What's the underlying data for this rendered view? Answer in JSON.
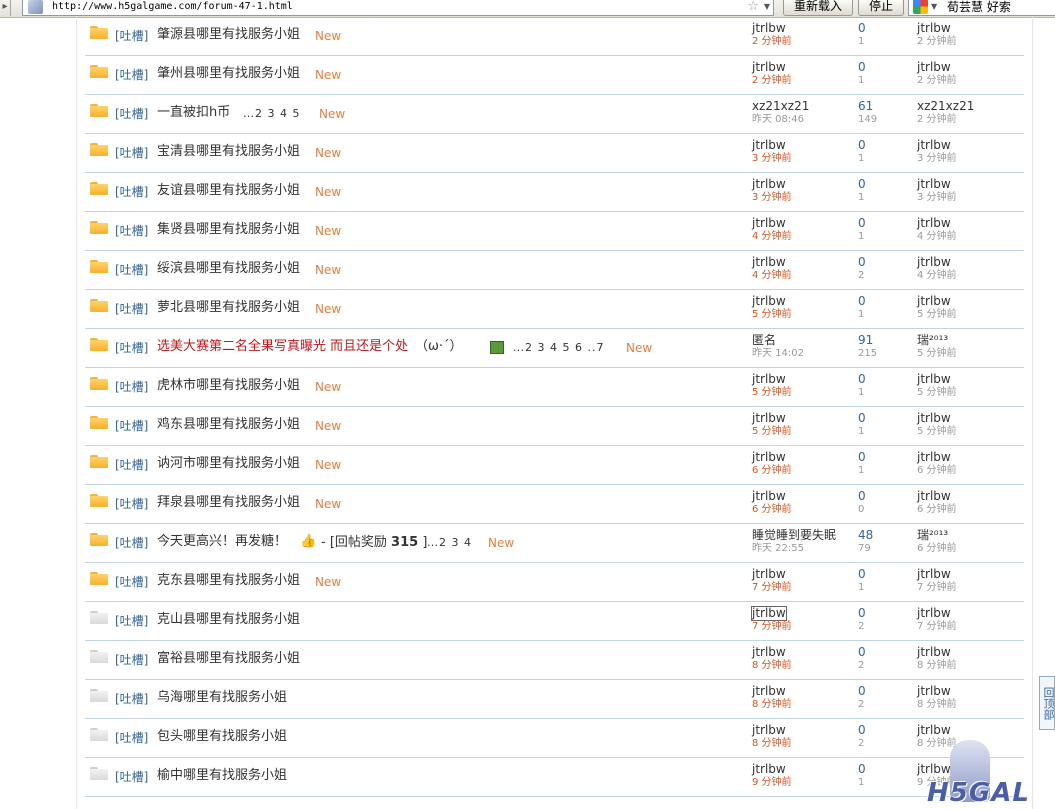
{
  "browser": {
    "url": "http://www.h5galgame.com/forum-47-1.html",
    "reload_label": "重新载入",
    "stop_label": "停止",
    "search_text": "荀芸慧 好索"
  },
  "threads": [
    {
      "icon": "new",
      "category": "[吐槽]",
      "subject": "肇源县哪里有找服务小姐",
      "new": "New",
      "author": "jtrlbw",
      "author_time": "2 分钟前",
      "replies": "0",
      "views": "1",
      "last_user": "jtrlbw",
      "last_time": "2 分钟前"
    },
    {
      "icon": "new",
      "category": "[吐槽]",
      "subject": "肇州县哪里有找服务小姐",
      "new": "New",
      "author": "jtrlbw",
      "author_time": "2 分钟前",
      "replies": "0",
      "views": "1",
      "last_user": "jtrlbw",
      "last_time": "2 分钟前"
    },
    {
      "icon": "new",
      "category": "[吐槽]",
      "subject": "一直被扣h币",
      "pages": "…2 3 4 5",
      "new": "New",
      "author": "xz21xz21",
      "author_time": "昨天 08:46",
      "replies": "61",
      "views": "149",
      "last_user": "xz21xz21",
      "last_time": "2 分钟前"
    },
    {
      "icon": "new",
      "category": "[吐槽]",
      "subject": "宝清县哪里有找服务小姐",
      "new": "New",
      "author": "jtrlbw",
      "author_time": "3 分钟前",
      "replies": "0",
      "views": "1",
      "last_user": "jtrlbw",
      "last_time": "3 分钟前"
    },
    {
      "icon": "new",
      "category": "[吐槽]",
      "subject": "友谊县哪里有找服务小姐",
      "new": "New",
      "author": "jtrlbw",
      "author_time": "3 分钟前",
      "replies": "0",
      "views": "1",
      "last_user": "jtrlbw",
      "last_time": "3 分钟前"
    },
    {
      "icon": "new",
      "category": "[吐槽]",
      "subject": "集贤县哪里有找服务小姐",
      "new": "New",
      "author": "jtrlbw",
      "author_time": "4 分钟前",
      "replies": "0",
      "views": "1",
      "last_user": "jtrlbw",
      "last_time": "4 分钟前"
    },
    {
      "icon": "new",
      "category": "[吐槽]",
      "subject": "绥滨县哪里有找服务小姐",
      "new": "New",
      "author": "jtrlbw",
      "author_time": "4 分钟前",
      "replies": "0",
      "views": "2",
      "last_user": "jtrlbw",
      "last_time": "4 分钟前"
    },
    {
      "icon": "new",
      "category": "[吐槽]",
      "subject": "萝北县哪里有找服务小姐",
      "new": "New",
      "author": "jtrlbw",
      "author_time": "5 分钟前",
      "replies": "0",
      "views": "1",
      "last_user": "jtrlbw",
      "last_time": "5 分钟前"
    },
    {
      "icon": "new",
      "category": "[吐槽]",
      "subject": "选美大赛第二名全果写真曝光 而且还是个处",
      "subject_extra": "（ω·´）",
      "pages": "…2 3 4 5 6 ..7",
      "new": "New",
      "author": "匿名",
      "author_time": "昨天 14:02",
      "replies": "91",
      "views": "215",
      "last_user": "瑞²⁰¹³",
      "last_time": "5 分钟前"
    },
    {
      "icon": "new",
      "category": "[吐槽]",
      "subject": "虎林市哪里有找服务小姐",
      "new": "New",
      "author": "jtrlbw",
      "author_time": "5 分钟前",
      "replies": "0",
      "views": "1",
      "last_user": "jtrlbw",
      "last_time": "5 分钟前"
    },
    {
      "icon": "new",
      "category": "[吐槽]",
      "subject": "鸡东县哪里有找服务小姐",
      "new": "New",
      "author": "jtrlbw",
      "author_time": "5 分钟前",
      "replies": "0",
      "views": "1",
      "last_user": "jtrlbw",
      "last_time": "5 分钟前"
    },
    {
      "icon": "new",
      "category": "[吐槽]",
      "subject": "讷河市哪里有找服务小姐",
      "new": "New",
      "author": "jtrlbw",
      "author_time": "6 分钟前",
      "replies": "0",
      "views": "1",
      "last_user": "jtrlbw",
      "last_time": "6 分钟前"
    },
    {
      "icon": "new",
      "category": "[吐槽]",
      "subject": "拜泉县哪里有找服务小姐",
      "new": "New",
      "author": "jtrlbw",
      "author_time": "6 分钟前",
      "replies": "0",
      "views": "0",
      "last_user": "jtrlbw",
      "last_time": "6 分钟前"
    },
    {
      "icon": "new",
      "category": "[吐槽]",
      "subject": "今天更高兴！再发糖！",
      "reward": "- [回帖奖励",
      "reward_num": "315",
      "reward_end": "]",
      "pages": "…2 3 4",
      "new": "New",
      "author": "睡觉睡到要失眠",
      "author_time": "昨天 22:55",
      "replies": "48",
      "views": "79",
      "last_user": "瑞²⁰¹³",
      "last_time": "6 分钟前"
    },
    {
      "icon": "new",
      "category": "[吐槽]",
      "subject": "克东县哪里有找服务小姐",
      "new": "New",
      "author": "jtrlbw",
      "author_time": "7 分钟前",
      "replies": "0",
      "views": "1",
      "last_user": "jtrlbw",
      "last_time": "7 分钟前"
    },
    {
      "icon": "old",
      "category": "[吐槽]",
      "subject": "克山县哪里有找服务小姐",
      "author": "jtrlbw",
      "author_time": "7 分钟前",
      "replies": "0",
      "views": "2",
      "last_user": "jtrlbw",
      "last_time": "7 分钟前"
    },
    {
      "icon": "old",
      "category": "[吐槽]",
      "subject": "富裕县哪里有找服务小姐",
      "author": "jtrlbw",
      "author_time": "8 分钟前",
      "replies": "0",
      "views": "2",
      "last_user": "jtrlbw",
      "last_time": "8 分钟前"
    },
    {
      "icon": "old",
      "category": "[吐槽]",
      "subject": "乌海哪里有找服务小姐",
      "author": "jtrlbw",
      "author_time": "8 分钟前",
      "replies": "0",
      "views": "2",
      "last_user": "jtrlbw",
      "last_time": "8 分钟前"
    },
    {
      "icon": "old",
      "category": "[吐槽]",
      "subject": "包头哪里有找服务小姐",
      "author": "jtrlbw",
      "author_time": "8 分钟前",
      "replies": "0",
      "views": "2",
      "last_user": "jtrlbw",
      "last_time": "8 分钟前"
    },
    {
      "icon": "old",
      "category": "[吐槽]",
      "subject": "榆中哪里有找服务小姐",
      "author": "jtrlbw",
      "author_time": "9 分钟前",
      "replies": "0",
      "views": "1",
      "last_user": "jtrlbw",
      "last_time": "9 分钟前"
    }
  ],
  "back_to_top": "回顶部",
  "logo_text": "H5GAL"
}
